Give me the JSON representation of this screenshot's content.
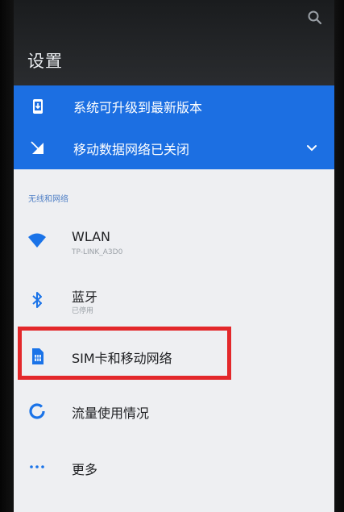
{
  "header": {
    "title": "设置",
    "search_icon": "search-icon"
  },
  "suggestions": [
    {
      "label": "系统可升级到最新版本",
      "icon": "system-update-icon"
    },
    {
      "label": "移动数据网络已关闭",
      "icon": "mobile-data-off-icon",
      "chevron": "chevron-down-icon"
    }
  ],
  "section": {
    "title": "无线和网络"
  },
  "items": [
    {
      "title": "WLAN",
      "subtitle": "TP-LINK_A3D0",
      "icon": "wifi-icon"
    },
    {
      "title": "蓝牙",
      "subtitle": "已停用",
      "icon": "bluetooth-icon"
    },
    {
      "title": "SIM卡和移动网络",
      "icon": "sim-card-icon"
    },
    {
      "title": "流量使用情况",
      "icon": "data-usage-icon"
    },
    {
      "title": "更多",
      "icon": "more-icon"
    }
  ],
  "colors": {
    "accent": "#1c6fe2",
    "icon_blue": "#1a73e8",
    "highlight": "#e3282b",
    "app_bar": "#2a2c2f",
    "list_bg": "#eeeff2"
  }
}
